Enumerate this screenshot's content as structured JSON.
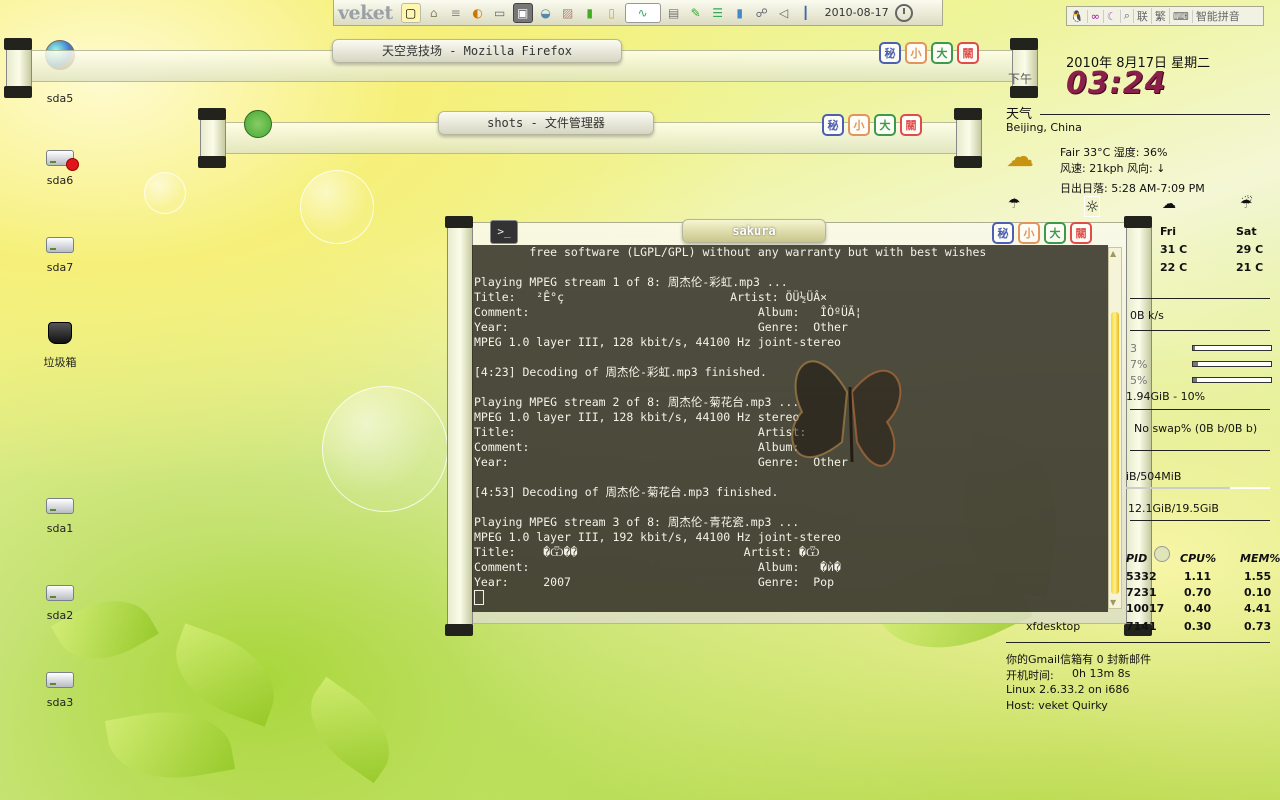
{
  "panel": {
    "brand": "veket",
    "date": "2010-08-17",
    "tray_icons": [
      "desktop-icon",
      "terminal-icon",
      "file-manager-icon",
      "browser-icon",
      "monitor-icon",
      "screenshot-icon",
      "paint-icon",
      "image-icon",
      "cpu-graph-icon",
      "memory-graph-icon",
      "net-graph-icon",
      "clipboard-icon",
      "edit-icon",
      "stack-icon",
      "drive-icon",
      "network-icon",
      "volume-icon",
      "thermometer-icon"
    ]
  },
  "ime": {
    "items": [
      "",
      "",
      "",
      "联",
      "繁",
      "",
      "智能拼音"
    ]
  },
  "desktop": {
    "icons": [
      {
        "label": "sda5",
        "type": "drive-icon"
      },
      {
        "label": "sda6",
        "type": "drive-icon"
      },
      {
        "label": "sda7",
        "type": "drive-icon"
      },
      {
        "label": "垃圾箱",
        "type": "trash-icon"
      },
      {
        "label": "sda1",
        "type": "drive-icon"
      },
      {
        "label": "sda2",
        "type": "drive-icon"
      },
      {
        "label": "sda3",
        "type": "drive-icon"
      }
    ]
  },
  "windows": {
    "firefox": {
      "title": "天空竞技场 - Mozilla Firefox"
    },
    "files": {
      "title": "shots - 文件管理器"
    },
    "terminal": {
      "title": "sakura"
    },
    "buttons": [
      "秘",
      "小",
      "大",
      "關"
    ]
  },
  "terminal": {
    "lines": [
      "        free software (LGPL/GPL) without any warranty but with best wishes",
      "",
      "Playing MPEG stream 1 of 8: 周杰伦-彩虹.mp3 ...",
      "Title:   ²Ê°ç                        Artist: ÖÜ½ÜÂ×",
      "Comment:                                 Album:   ÎÒºÜÃ¦",
      "Year:                                    Genre:  Other",
      "MPEG 1.0 layer III, 128 kbit/s, 44100 Hz joint-stereo",
      "",
      "[4:23] Decoding of 周杰伦-彩虹.mp3 finished.",
      "",
      "Playing MPEG stream 2 of 8: 周杰伦-菊花台.mp3 ...",
      "MPEG 1.0 layer III, 128 kbit/s, 44100 Hz stereo",
      "Title:                                   Artist:",
      "Comment:                                 Album:",
      "Year:                                    Genre:  Other",
      "",
      "[4:53] Decoding of 周杰伦-菊花台.mp3 finished.",
      "",
      "Playing MPEG stream 3 of 8: 周杰伦-青花瓷.mp3 ...",
      "MPEG 1.0 layer III, 192 kbit/s, 44100 Hz joint-stereo",
      "Title:    �Ѿ��                        Artist: �Ѿ",
      "Comment:                                 Album:   �ѝ�",
      "Year:     2007                           Genre:  Pop"
    ]
  },
  "conky": {
    "ampm": "下午",
    "date": "2010年 8月17日 星期二",
    "time": "03:24",
    "weather_title": "天气",
    "location": "Beijing, China",
    "condition": "Fair  33°C 湿度: 36%",
    "wind": "风速: 21kph 风向: ↓",
    "sun": "日出日落: 5:28 AM-7:09 PM",
    "forecast": [
      {
        "day": "Fri",
        "high": "31 C",
        "low": "22 C"
      },
      {
        "day": "Sat",
        "high": "29 C",
        "low": "21 C"
      }
    ],
    "net": "0B  k/s",
    "cpu_rows": [
      {
        "label": "3",
        "value": 0.03
      },
      {
        "label": "7%",
        "value": 0.07
      },
      {
        "label": "5%",
        "value": 0.05
      }
    ],
    "disk": "1.94GiB - 10%",
    "swap": "No swap% (0B  b/0B  b)",
    "mem": "iB/504MiB",
    "mem_fill": 0.72,
    "home": "12.1GiB/19.5GiB",
    "proc_headers": [
      "PID",
      "CPU%",
      "MEM%"
    ],
    "procs": [
      {
        "name": "",
        "pid": "5332",
        "cpu": "1.11",
        "mem": "1.55"
      },
      {
        "name": "",
        "pid": "7231",
        "cpu": "0.70",
        "mem": "0.10"
      },
      {
        "name": "",
        "pid": "10017",
        "cpu": "0.40",
        "mem": "4.41"
      },
      {
        "name": "xfdesktop",
        "pid": "7141",
        "cpu": "0.30",
        "mem": "0.73"
      }
    ],
    "gmail": "你的Gmail信箱有 0 封新邮件",
    "uptime_label": "开机时间:",
    "uptime": "0h 13m 8s",
    "kernel": "Linux 2.6.33.2 on i686",
    "host": "Host: veket Quirky"
  }
}
